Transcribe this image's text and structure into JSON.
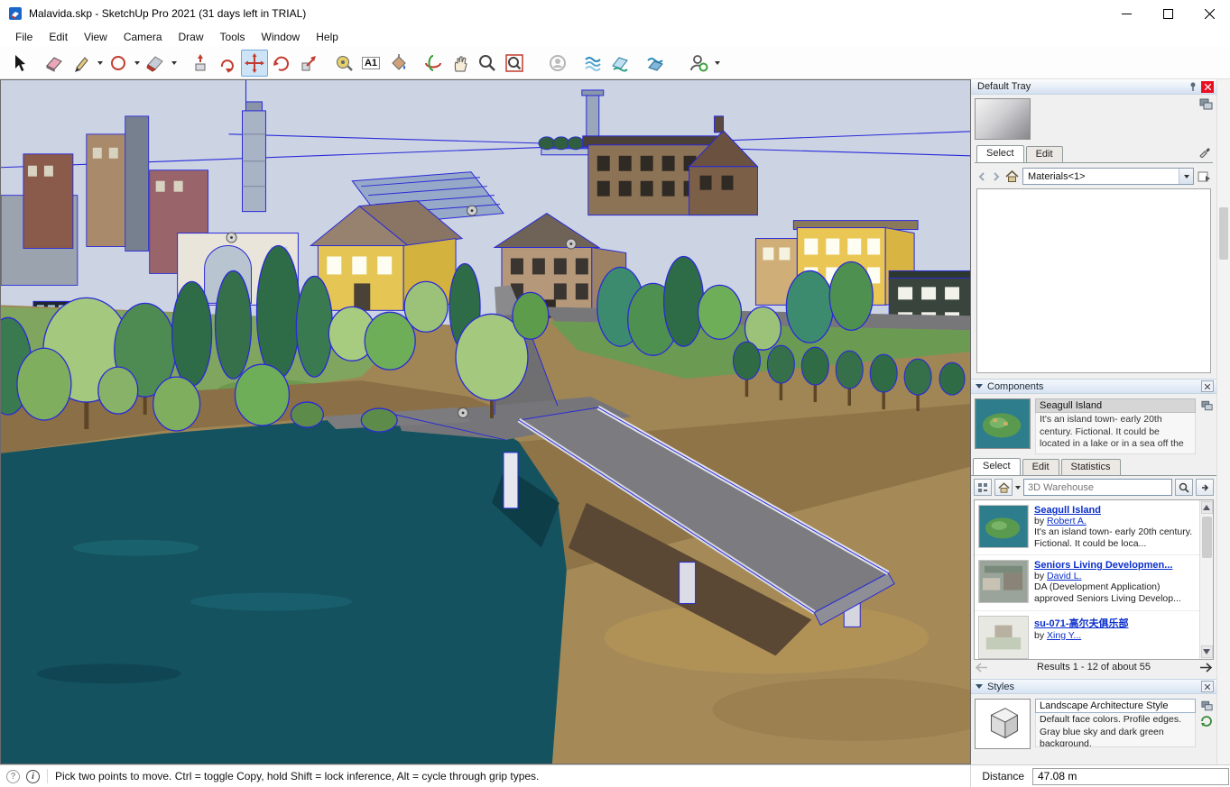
{
  "window": {
    "title": "Malavida.skp - SketchUp Pro 2021 (31 days left in TRIAL)"
  },
  "menu": {
    "items": [
      "File",
      "Edit",
      "View",
      "Camera",
      "Draw",
      "Tools",
      "Window",
      "Help"
    ]
  },
  "toolbar": {
    "active_tool": "move",
    "text_tool_glyph": "A1",
    "tools": [
      "select",
      "eraser",
      "line",
      "shapes",
      "rotated-rectangle",
      "push-pull",
      "follow-me",
      "move",
      "rotate",
      "scale",
      "tape-measure",
      "text",
      "paint-bucket",
      "orbit",
      "pan",
      "zoom",
      "zoom-extents",
      "look-around",
      "section-plane",
      "section-display",
      "section-fill",
      "sign-in"
    ]
  },
  "tray": {
    "title": "Default Tray",
    "materials": {
      "tabs": {
        "select": "Select",
        "edit": "Edit"
      },
      "collection": "Materials<1>"
    },
    "components": {
      "header": "Components",
      "preview": {
        "name": "Seagull Island",
        "description": "It's an island town- early 20th century. Fictional. It could be located in a lake or in a sea off the ..."
      },
      "tabs": {
        "select": "Select",
        "edit": "Edit",
        "statistics": "Statistics"
      },
      "search_placeholder": "3D Warehouse",
      "results": [
        {
          "title": "Seagull Island",
          "by": "by",
          "author": "Robert A.",
          "description": "It's an island town- early 20th century. Fictional. It could be loca..."
        },
        {
          "title": "Seniors Living Developmen...",
          "by": "by",
          "author": "David L.",
          "description": "DA (Development Application) approved Seniors Living Develop..."
        },
        {
          "title": "su-071-高尔夫俱乐部",
          "by": "by",
          "author": "Xing Y...",
          "description": ""
        }
      ],
      "pagination": "Results 1 - 12 of about 55"
    },
    "styles": {
      "header": "Styles",
      "name": "Landscape Architecture Style",
      "description": "Default face colors. Profile edges. Gray blue sky and dark green background."
    }
  },
  "statusbar": {
    "hint": "Pick two points to move.  Ctrl = toggle Copy, hold Shift = lock inference, Alt = cycle through grip types.",
    "measure_label": "Distance",
    "measure_value": "47.08 m"
  },
  "scene": {
    "selection_color": "#2a2ad8",
    "sky_color": "#ccd4e4",
    "water_color": "#14525f"
  }
}
